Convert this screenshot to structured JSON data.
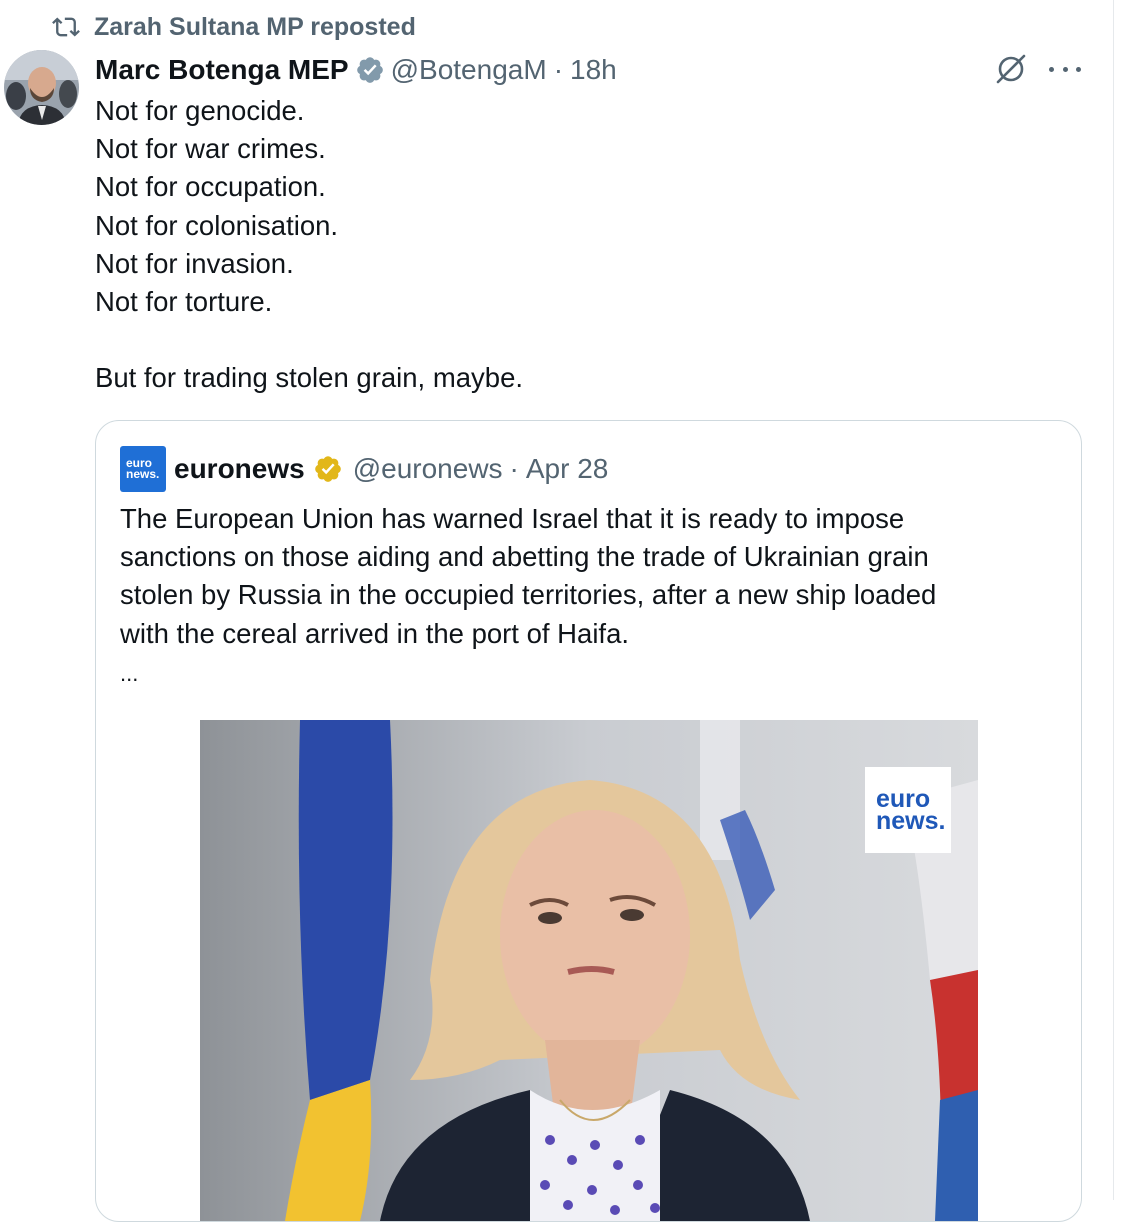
{
  "repost": {
    "text": "Zarah Sultana MP reposted",
    "icon": "repost-icon"
  },
  "post": {
    "author_name": "Marc Botenga MEP",
    "author_handle": "@BotengaM",
    "separator": "·",
    "time": "18h",
    "lines": [
      "Not for genocide.",
      "Not for war crimes.",
      "Not for occupation.",
      "Not for colonisation.",
      "Not for invasion.",
      "Not for torture.",
      "",
      "But for trading stolen grain, maybe."
    ]
  },
  "quote": {
    "logo_top": "euro",
    "logo_bottom": "news.",
    "author_name": "euronews",
    "author_handle": "@euronews",
    "separator": "·",
    "time": "Apr 28",
    "lines": [
      "The European Union has warned Israel that it is ready to impose",
      "sanctions on those aiding and abetting the trade of Ukrainian grain",
      "stolen by Russia in the occupied territories, after a new ship loaded",
      "with the cereal arrived in the port of Haifa."
    ],
    "ellipsis": "...",
    "media_logo_top": "euro",
    "media_logo_bottom": "news."
  },
  "colors": {
    "text": "#0f1419",
    "secondary": "#536471",
    "verified_blue": "#1d9bf0",
    "gold_badge": "#e2b719",
    "euronews_blue": "#1f6fd6",
    "border": "#cfd9de"
  }
}
